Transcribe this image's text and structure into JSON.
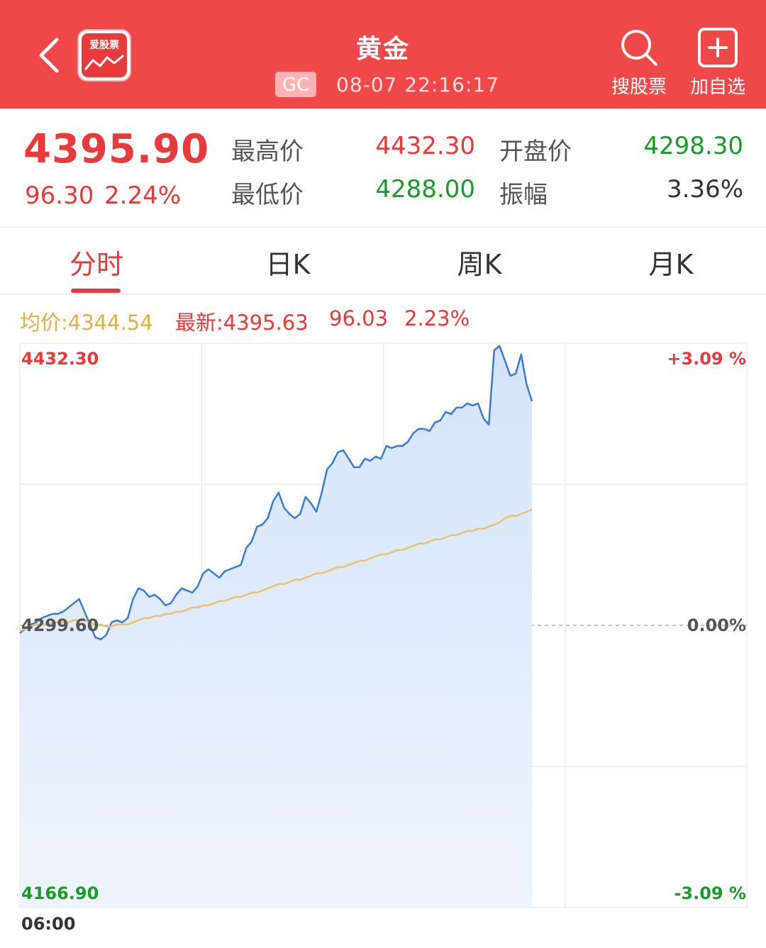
{
  "header": {
    "title": "黄金",
    "logo_text": "爱股票",
    "code": "GC",
    "datetime": "08-07 22:16:17",
    "search_label": "搜股票",
    "add_label": "加自选",
    "bg_color": "#f04848"
  },
  "quote": {
    "price": "4395.90",
    "change": "96.30",
    "change_pct": "2.24%",
    "high_label": "最高价",
    "high": "4432.30",
    "low_label": "最低价",
    "low": "4288.00",
    "open_label": "开盘价",
    "open": "4298.30",
    "amp_label": "振幅",
    "amp": "3.36%",
    "colors": {
      "up": "#e83a3a",
      "down": "#1a9a2a",
      "neutral": "#333333"
    }
  },
  "tabs": [
    "分时",
    "日K",
    "周K",
    "月K"
  ],
  "active_tab": 0,
  "info": {
    "avg_label": "均价:4344.54",
    "latest_label": "最新:4395.63",
    "latest_change": "96.03",
    "latest_pct": "2.23%",
    "avg_color": "#e8b840",
    "latest_color": "#e83a3a"
  },
  "chart_data": {
    "type": "area",
    "y_max_label": "4432.30",
    "y_min_label": "4166.90",
    "y_mid_label": "4299.60",
    "pct_max_label": "+3.09 %",
    "pct_mid_label": "0.00%",
    "pct_min_label": "-3.09 %",
    "x_start_label": "06:00",
    "ylim": [
      4166.9,
      4432.3
    ],
    "prev_close": 4299.6,
    "grid": true,
    "series": [
      {
        "values": [
          4296,
          4298,
          4300,
          4301,
          4303,
          4304,
          4305,
          4305,
          4306,
          4308,
          4310,
          4312,
          4306,
          4300,
          4294,
          4293,
          4295,
          4301,
          4302,
          4301,
          4303,
          4312,
          4317,
          4316,
          4313,
          4314,
          4312,
          4309,
          4310,
          4314,
          4317,
          4316,
          4315,
          4318,
          4324,
          4326,
          4324,
          4322,
          4325,
          4326,
          4327,
          4328,
          4336,
          4339,
          4346,
          4347,
          4350,
          4358,
          4362,
          4355,
          4352,
          4350,
          4352,
          4360,
          4357,
          4353,
          4362,
          4373,
          4376,
          4381,
          4382,
          4378,
          4374,
          4374,
          4378,
          4377,
          4379,
          4378,
          4384,
          4383,
          4384,
          4384,
          4386,
          4390,
          4392,
          4392,
          4391,
          4395,
          4396,
          4400,
          4399,
          4402,
          4402,
          4404,
          4403,
          4404,
          4397,
          4394,
          4429,
          4431,
          4424,
          4417,
          4418,
          4427,
          4413,
          4405
        ]
      },
      {
        "values": [
          4297,
          4298,
          4299,
          4300,
          4300,
          4300,
          4301,
          4301,
          4301,
          4301,
          4302,
          4302,
          4302,
          4301,
          4300,
          4300,
          4299,
          4299,
          4300,
          4300,
          4300,
          4301,
          4302,
          4303,
          4303,
          4304,
          4304,
          4305,
          4305,
          4306,
          4306,
          4307,
          4308,
          4308,
          4309,
          4309,
          4310,
          4311,
          4311,
          4312,
          4313,
          4313,
          4314,
          4315,
          4315,
          4316,
          4317,
          4318,
          4319,
          4319,
          4320,
          4321,
          4321,
          4322,
          4323,
          4324,
          4324,
          4325,
          4326,
          4327,
          4327,
          4328,
          4329,
          4330,
          4330,
          4331,
          4332,
          4333,
          4333,
          4334,
          4335,
          4335,
          4336,
          4337,
          4338,
          4338,
          4339,
          4340,
          4340,
          4341,
          4342,
          4342,
          4343,
          4344,
          4344,
          4345,
          4345,
          4346,
          4347,
          4348,
          4350,
          4351,
          4351,
          4352,
          4353,
          4354
        ]
      }
    ],
    "colors": {
      "price_line": "#3a7ad6",
      "avg_line": "#e8c070",
      "area": "#dceafa",
      "grid": "#ececec",
      "mid_line": "#b0b0b0",
      "up": "#e83a3a",
      "down": "#1a9a2a"
    }
  }
}
